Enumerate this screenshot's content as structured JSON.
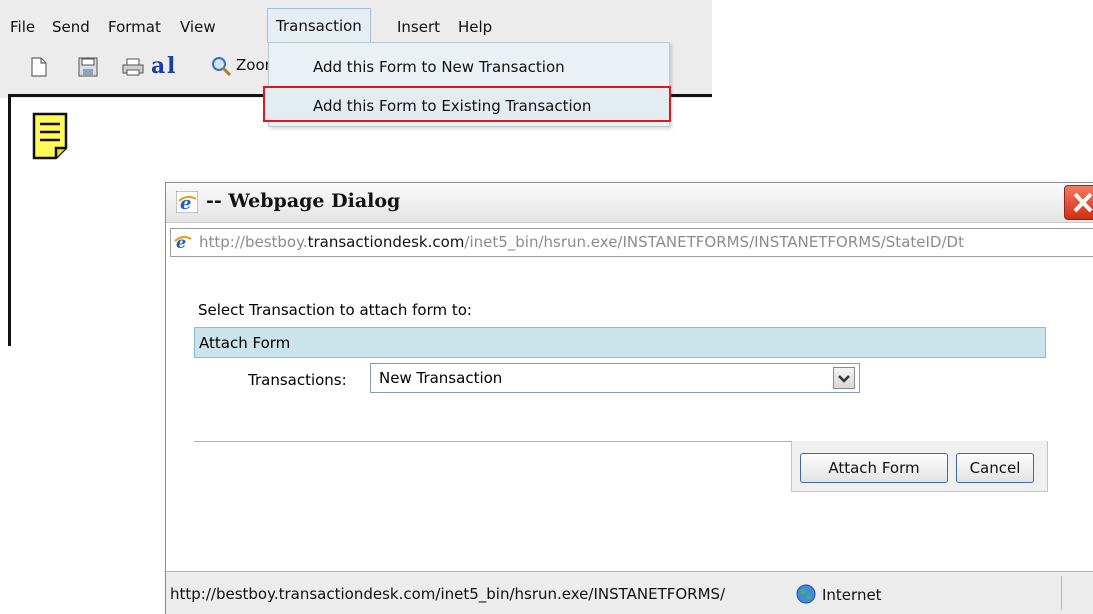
{
  "menubar": {
    "items": [
      "File",
      "Send",
      "Format",
      "View",
      "Transaction",
      "Insert",
      "Help"
    ]
  },
  "toolbar": {
    "zoom_label": "Zoom"
  },
  "dropdown": {
    "items": [
      "Add this Form to New Transaction",
      "Add this Form to Existing Transaction"
    ]
  },
  "dialog": {
    "title": "-- Webpage Dialog",
    "address_prefix": "http://bestboy.",
    "address_domain": "transactiondesk.com",
    "address_path": "/inet5_bin/hsrun.exe/INSTANETFORMS/INSTANETFORMS/StateID/Dt",
    "select_label": "Select Transaction to attach form to:",
    "section_header": "Attach Form",
    "transactions_label": "Transactions:",
    "transactions_value": "New Transaction",
    "attach_button": "Attach Form",
    "cancel_button": "Cancel",
    "status_url": "http://bestboy.transactiondesk.com/inet5_bin/hsrun.exe/INSTANETFORMS/",
    "status_zone": "Internet"
  },
  "colors": {
    "highlight_border": "#e0161b",
    "section_header_bg": "#cbe3ea",
    "close_button": "#cf2f12"
  }
}
